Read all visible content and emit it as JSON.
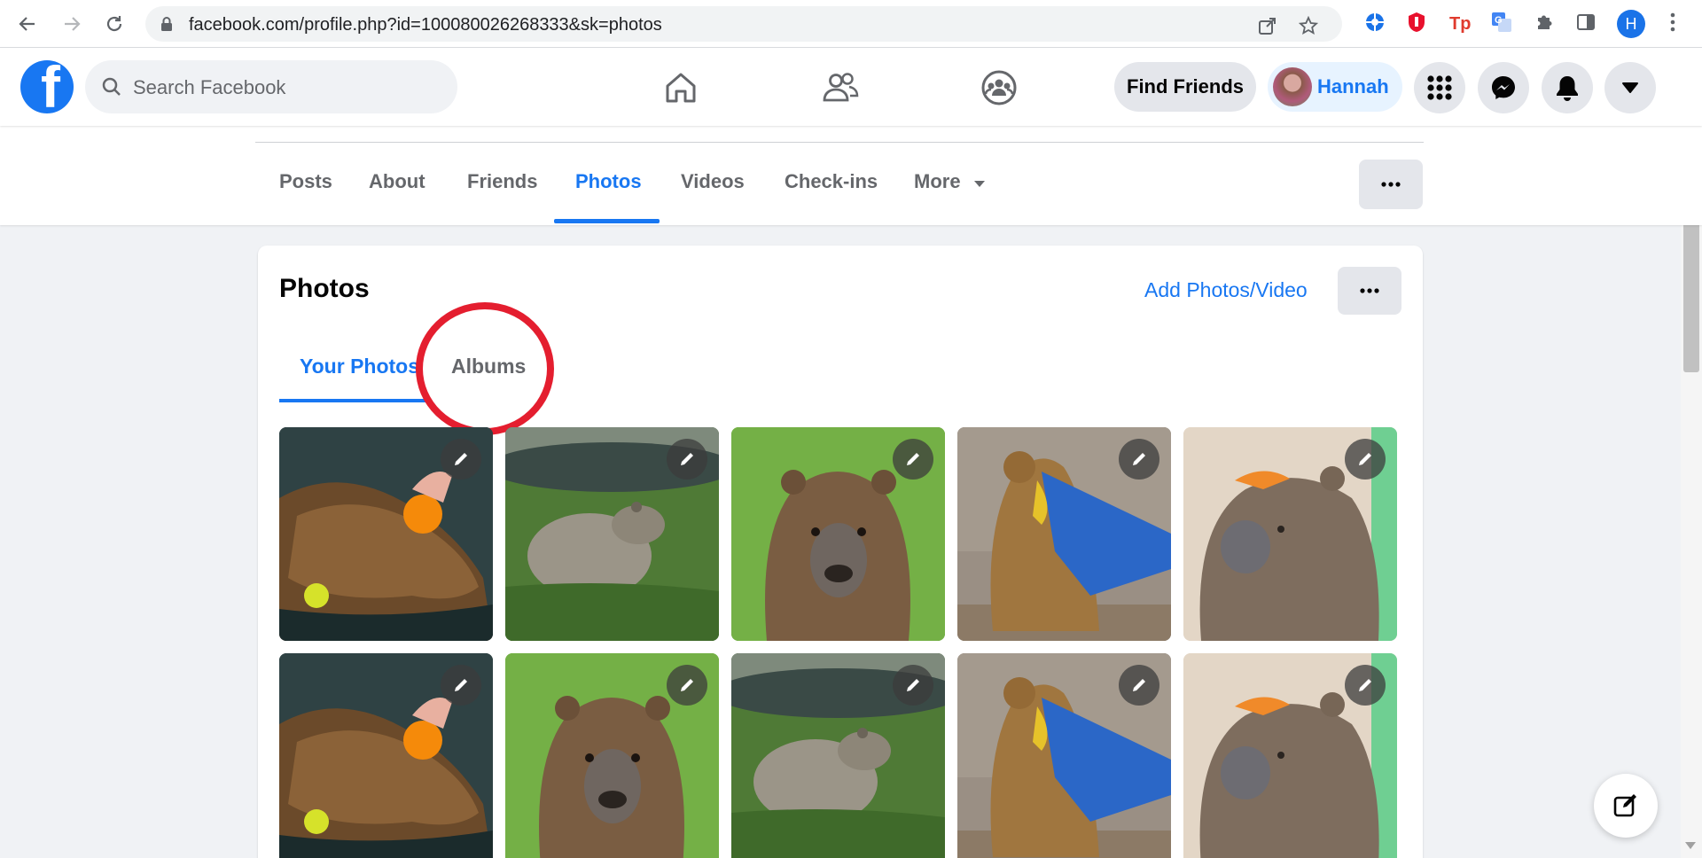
{
  "browser": {
    "url": "facebook.com/profile.php?id=100080026268333&sk=photos",
    "profile_initial": "H"
  },
  "header": {
    "logo_letter": "f",
    "search_placeholder": "Search Facebook",
    "find_friends": "Find Friends",
    "user_name": "Hannah"
  },
  "profile_tabs": [
    {
      "label": "Posts"
    },
    {
      "label": "About"
    },
    {
      "label": "Friends"
    },
    {
      "label": "Photos",
      "active": true
    },
    {
      "label": "Videos"
    },
    {
      "label": "Check-ins"
    },
    {
      "label": "More"
    }
  ],
  "photos_card": {
    "title": "Photos",
    "add_button": "Add Photos/Video",
    "subtabs": [
      {
        "label": "Your Photos",
        "active": true
      },
      {
        "label": "Albums"
      }
    ]
  },
  "colors": {
    "fb_blue": "#1877f2",
    "annotation_red": "#e41e2f"
  }
}
